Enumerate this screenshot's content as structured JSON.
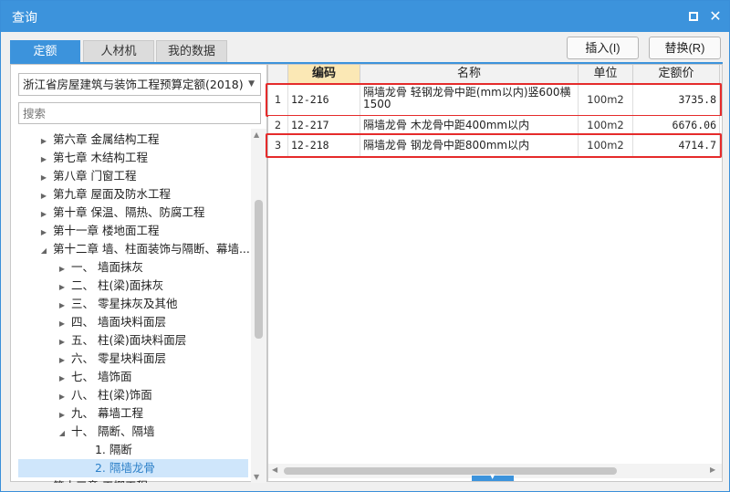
{
  "window": {
    "title": "查询"
  },
  "tabs": [
    {
      "label": "定额",
      "active": true
    },
    {
      "label": "人材机",
      "active": false
    },
    {
      "label": "我的数据",
      "active": false
    }
  ],
  "toolbar": {
    "insert_label": "插入(I)",
    "replace_label": "替换(R)"
  },
  "left_panel": {
    "quota_select": "浙江省房屋建筑与装饰工程预算定额(2018)",
    "search_placeholder": "搜索",
    "tree": [
      {
        "label": "第六章 金属结构工程",
        "level": 0,
        "state": "collapsed"
      },
      {
        "label": "第七章 木结构工程",
        "level": 0,
        "state": "collapsed"
      },
      {
        "label": "第八章 门窗工程",
        "level": 0,
        "state": "collapsed"
      },
      {
        "label": "第九章 屋面及防水工程",
        "level": 0,
        "state": "collapsed"
      },
      {
        "label": "第十章 保温、隔热、防腐工程",
        "level": 0,
        "state": "collapsed"
      },
      {
        "label": "第十一章 楼地面工程",
        "level": 0,
        "state": "collapsed"
      },
      {
        "label": "第十二章 墙、柱面装饰与隔断、幕墙...",
        "level": 0,
        "state": "expanded"
      },
      {
        "label": "一、 墙面抹灰",
        "level": 1,
        "state": "collapsed"
      },
      {
        "label": "二、 柱(梁)面抹灰",
        "level": 1,
        "state": "collapsed"
      },
      {
        "label": "三、 零星抹灰及其他",
        "level": 1,
        "state": "collapsed"
      },
      {
        "label": "四、 墙面块料面层",
        "level": 1,
        "state": "collapsed"
      },
      {
        "label": "五、 柱(梁)面块料面层",
        "level": 1,
        "state": "collapsed"
      },
      {
        "label": "六、 零星块料面层",
        "level": 1,
        "state": "collapsed"
      },
      {
        "label": "七、 墙饰面",
        "level": 1,
        "state": "collapsed"
      },
      {
        "label": "八、 柱(梁)饰面",
        "level": 1,
        "state": "collapsed"
      },
      {
        "label": "九、 幕墙工程",
        "level": 1,
        "state": "collapsed"
      },
      {
        "label": "十、 隔断、隔墙",
        "level": 1,
        "state": "expanded"
      },
      {
        "label": "1. 隔断",
        "level": 2,
        "state": "leaf"
      },
      {
        "label": "2. 隔墙龙骨",
        "level": 2,
        "state": "leaf",
        "selected": true
      },
      {
        "label": "第十三章 天棚工程",
        "level": 0,
        "state": "collapsed"
      }
    ]
  },
  "grid": {
    "headers": {
      "code": "编码",
      "name": "名称",
      "unit": "单位",
      "price": "定额价"
    },
    "rows": [
      {
        "num": "1",
        "code": "12-216",
        "name": "隔墙龙骨 轻钢龙骨中距(mm以内)竖600横1500",
        "unit": "100m2",
        "price": "3735.8",
        "highlighted": true
      },
      {
        "num": "2",
        "code": "12-217",
        "name": "隔墙龙骨 木龙骨中距400mm以内",
        "unit": "100m2",
        "price": "6676.06",
        "highlighted": false
      },
      {
        "num": "3",
        "code": "12-218",
        "name": "隔墙龙骨 钢龙骨中距800mm以内",
        "unit": "100m2",
        "price": "4714.7",
        "highlighted": true
      }
    ]
  },
  "colors": {
    "accent": "#3c93dc",
    "highlight": "#e52b2b",
    "code_header": "#fbe8b5",
    "selected_row": "#cfe6fb"
  },
  "icons": {
    "maximize": "maximize-icon",
    "close": "close-icon",
    "dropdown": "chevron-down-icon"
  }
}
